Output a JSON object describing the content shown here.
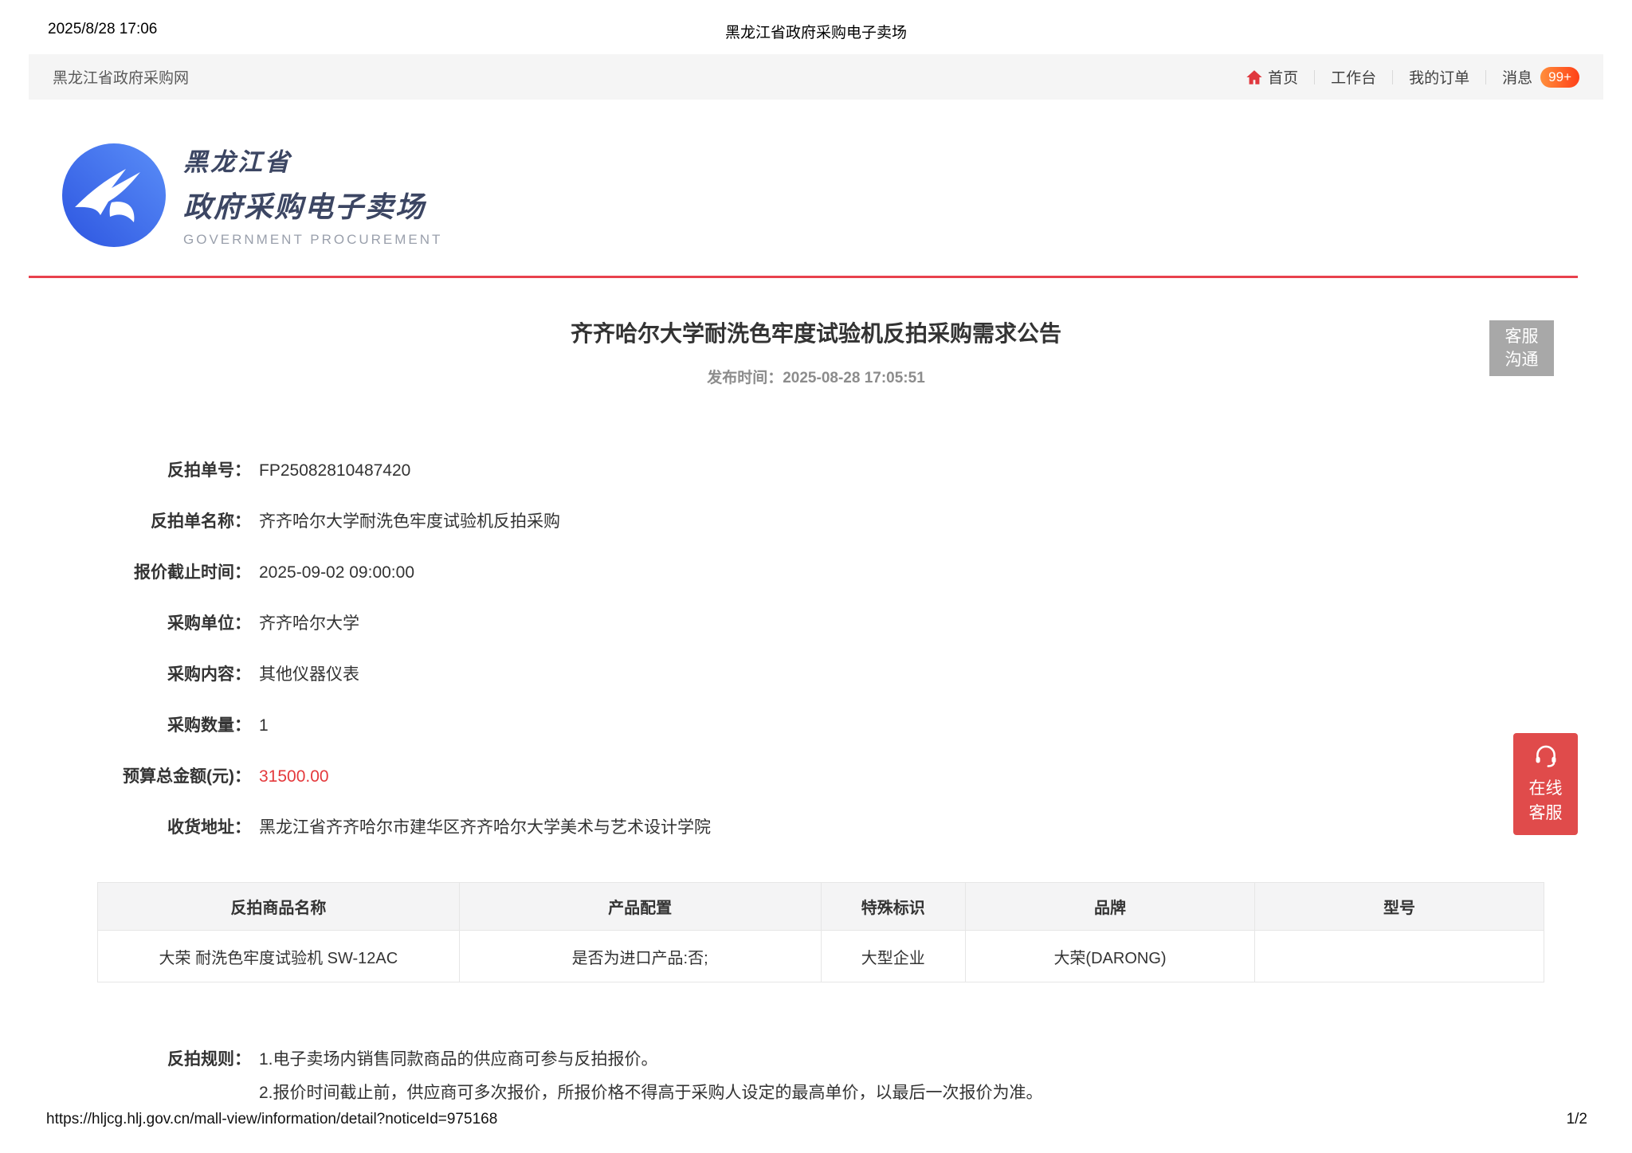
{
  "print_header": {
    "datetime": "2025/8/28 17:06",
    "title": "黑龙江省政府采购电子卖场"
  },
  "navbar": {
    "site_name": "黑龙江省政府采购网",
    "items": [
      {
        "label": "首页"
      },
      {
        "label": "工作台"
      },
      {
        "label": "我的订单"
      },
      {
        "label": "消息"
      }
    ],
    "message_badge": "99+"
  },
  "logo": {
    "line1": "黑龙江省",
    "line2": "政府采购电子卖场",
    "line3": "GOVERNMENT PROCUREMENT"
  },
  "notice": {
    "title": "齐齐哈尔大学耐洗色牢度试验机反拍采购需求公告",
    "publish": "发布时间：2025-08-28 17:05:51"
  },
  "service_box": {
    "line1": "客服",
    "line2": "沟通"
  },
  "online_service": {
    "line1": "在线",
    "line2": "客服"
  },
  "fields": [
    {
      "label": "反拍单号：",
      "value": "FP25082810487420"
    },
    {
      "label": "反拍单名称：",
      "value": "齐齐哈尔大学耐洗色牢度试验机反拍采购"
    },
    {
      "label": "报价截止时间：",
      "value": "2025-09-02 09:00:00"
    },
    {
      "label": "采购单位：",
      "value": "齐齐哈尔大学"
    },
    {
      "label": "采购内容：",
      "value": "其他仪器仪表"
    },
    {
      "label": "采购数量：",
      "value": "1"
    },
    {
      "label": "预算总金额(元)：",
      "value": "31500.00"
    },
    {
      "label": "收货地址：",
      "value": "黑龙江省齐齐哈尔市建华区齐齐哈尔大学美术与艺术设计学院"
    }
  ],
  "table": {
    "headers": [
      "反拍商品名称",
      "产品配置",
      "特殊标识",
      "品牌",
      "型号"
    ],
    "rows": [
      [
        "大荣 耐洗色牢度试验机 SW-12AC",
        "是否为进口产品:否;",
        "大型企业",
        "大荣(DARONG)",
        ""
      ]
    ]
  },
  "rules": {
    "label": "反拍规则：",
    "lines": [
      "1.电子卖场内销售同款商品的供应商可参与反拍报价。",
      "2.报价时间截止前，供应商可多次报价，所报价格不得高于采购人设定的最高单价，以最后一次报价为准。"
    ]
  },
  "footer": {
    "url": "https://hljcg.hlj.gov.cn/mall-view/information/detail?noticeId=975168",
    "page": "1/2"
  },
  "colors": {
    "accent_rule_red": "#e8414d",
    "price_red": "#e4393c",
    "online_service_red": "#e04b4b",
    "service_box_gray": "#a8a8a8",
    "nav_background": "#f5f5f5",
    "badge_gradient_start": "#ff8f3c",
    "badge_gradient_end": "#ff4018",
    "home_icon_red": "#e0383e",
    "logo_blue": "#3f6ef0",
    "logo_text_navy": "#3c4663",
    "table_header_bg": "#f4f4f5"
  }
}
